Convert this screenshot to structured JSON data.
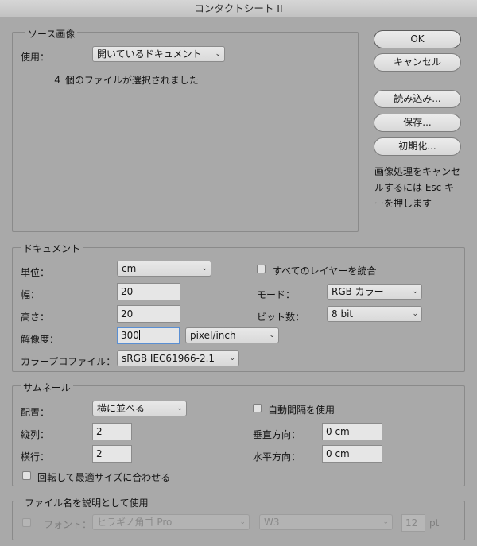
{
  "window": {
    "title": "コンタクトシート II"
  },
  "source": {
    "title": "ソース画像",
    "use_label": "使用：",
    "use_value": "開いているドキュメント",
    "status": "４ 個のファイルが選択されました"
  },
  "buttons": {
    "ok": "OK",
    "cancel": "キャンセル",
    "load": "読み込み...",
    "save": "保存...",
    "reset": "初期化..."
  },
  "note": "画像処理をキャンセルするには Esc キーを押します",
  "document": {
    "title": "ドキュメント",
    "unit_label": "単位：",
    "unit_value": "cm",
    "width_label": "幅：",
    "width_value": "20",
    "height_label": "高さ：",
    "height_value": "20",
    "resolution_label": "解像度：",
    "resolution_value": "300",
    "resolution_unit": "pixel/inch",
    "profile_label": "カラープロファイル：",
    "profile_value": "sRGB IEC61966-2.1",
    "flatten_label": "すべてのレイヤーを統合",
    "mode_label": "モード：",
    "mode_value": "RGB カラー",
    "bit_label": "ビット数：",
    "bit_value": "8 bit"
  },
  "thumbnail": {
    "title": "サムネール",
    "place_label": "配置：",
    "place_value": "横に並べる",
    "columns_label": "縦列：",
    "columns_value": "2",
    "rows_label": "横行：",
    "rows_value": "2",
    "rotate_label": "回転して最適サイズに合わせる",
    "auto_spacing_label": "自動間隔を使用",
    "vertical_label": "垂直方向：",
    "vertical_value": "0 cm",
    "horizontal_label": "水平方向：",
    "horizontal_value": "0 cm"
  },
  "caption": {
    "title": "ファイル名を説明として使用",
    "font_label": "フォント：",
    "font_value": "ヒラギノ角ゴ Pro",
    "weight_value": "W3",
    "size_value": "12",
    "size_unit": "pt"
  }
}
